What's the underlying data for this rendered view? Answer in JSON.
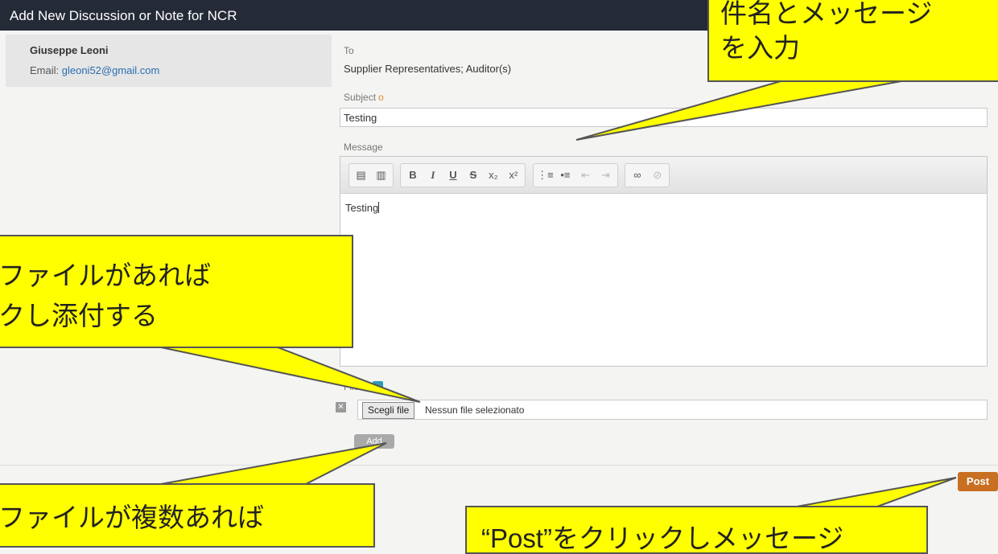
{
  "window": {
    "title": "Add New Discussion or Note for NCR"
  },
  "user": {
    "name": "Giuseppe Leoni",
    "email_label": "Email:",
    "email": "gleoni52@gmail.com"
  },
  "form": {
    "to_label": "To",
    "to_value": "Supplier Representatives; Auditor(s)",
    "subject_label": "Subject",
    "subject_required": "o",
    "subject_value": "Testing",
    "message_label": "Message",
    "message_value": "Testing",
    "files_label": "Files",
    "choose_file_label": "Scegli file",
    "no_file_label": "Nessun file selezionato",
    "add_label": "Add",
    "remove_symbol": "✕",
    "post_label": "Post"
  },
  "toolbar": {
    "groups": [
      [
        {
          "icon": "paste-icon",
          "glyph": "▤"
        },
        {
          "icon": "paste-text-icon",
          "glyph": "▥"
        }
      ],
      [
        {
          "icon": "bold-icon",
          "glyph": "B"
        },
        {
          "icon": "italic-icon",
          "glyph": "I"
        },
        {
          "icon": "underline-icon",
          "glyph": "U"
        },
        {
          "icon": "strikethrough-icon",
          "glyph": "S"
        },
        {
          "icon": "subscript-icon",
          "glyph": "x₂"
        },
        {
          "icon": "superscript-icon",
          "glyph": "x²"
        }
      ],
      [
        {
          "icon": "numbered-list-icon",
          "glyph": "⋮≡"
        },
        {
          "icon": "bulleted-list-icon",
          "glyph": "•≡"
        },
        {
          "icon": "outdent-icon",
          "glyph": "⇤"
        },
        {
          "icon": "indent-icon",
          "glyph": "⇥"
        }
      ],
      [
        {
          "icon": "link-icon",
          "glyph": "∞"
        },
        {
          "icon": "unlink-icon",
          "glyph": "⊘"
        }
      ]
    ]
  },
  "callouts": {
    "top_right": {
      "line1": "件名とメッセージ",
      "line2": "を入力"
    },
    "left_middle": {
      "line1": "ファイルがあれば",
      "line2": "クし添付する"
    },
    "bottom_left": {
      "line1": "ファイルが複数あれば"
    },
    "bottom_middle": {
      "line1": "“Post”をクリックしメッセージ"
    }
  },
  "colors": {
    "title_bar": "#252a37",
    "callout": "#ffff00",
    "post_button": "#c96f22",
    "link": "#2a6db0"
  }
}
